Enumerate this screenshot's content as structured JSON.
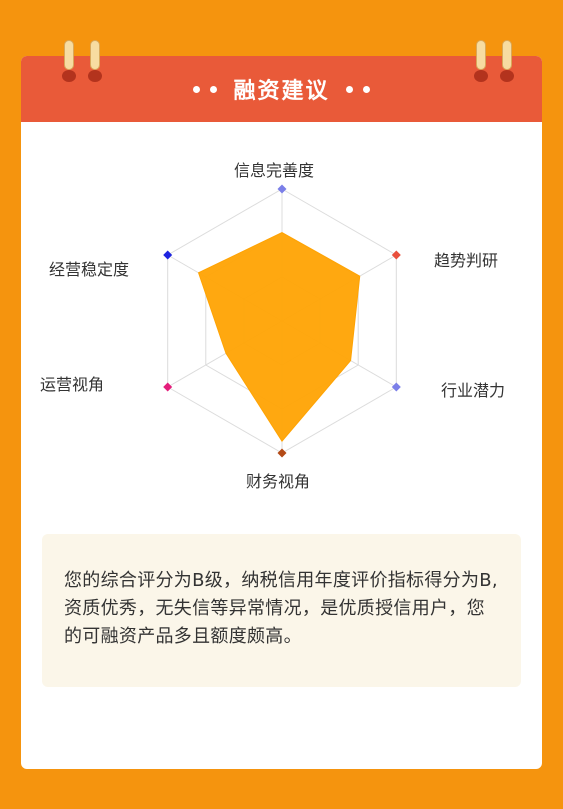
{
  "header": {
    "title": "融资建议"
  },
  "colors": {
    "background": "#f5940e",
    "header": "#e95a39",
    "fill": "#ffa303",
    "note_bg": "#fbf6e9"
  },
  "chart_data": {
    "type": "radar",
    "axes": [
      "信息完善度",
      "趋势判研",
      "行业潜力",
      "财务视角",
      "运营视角",
      "经营稳定度"
    ],
    "marker_colors": [
      "#7b7fe8",
      "#e94f3c",
      "#7b7fe8",
      "#b34a16",
      "#e41d7b",
      "#1d24e0"
    ],
    "values": [
      0.67,
      0.68,
      0.6,
      0.91,
      0.49,
      0.73
    ],
    "scale_max": 1,
    "rings": 3,
    "grid": true,
    "fill_color": "#ffa303"
  },
  "note": {
    "text": "您的综合评分为B级，纳税信用年度评价指标得分为B,资质优秀，无失信等异常情况，是优质授信用户，您的可融资产品多且额度颇高。"
  }
}
